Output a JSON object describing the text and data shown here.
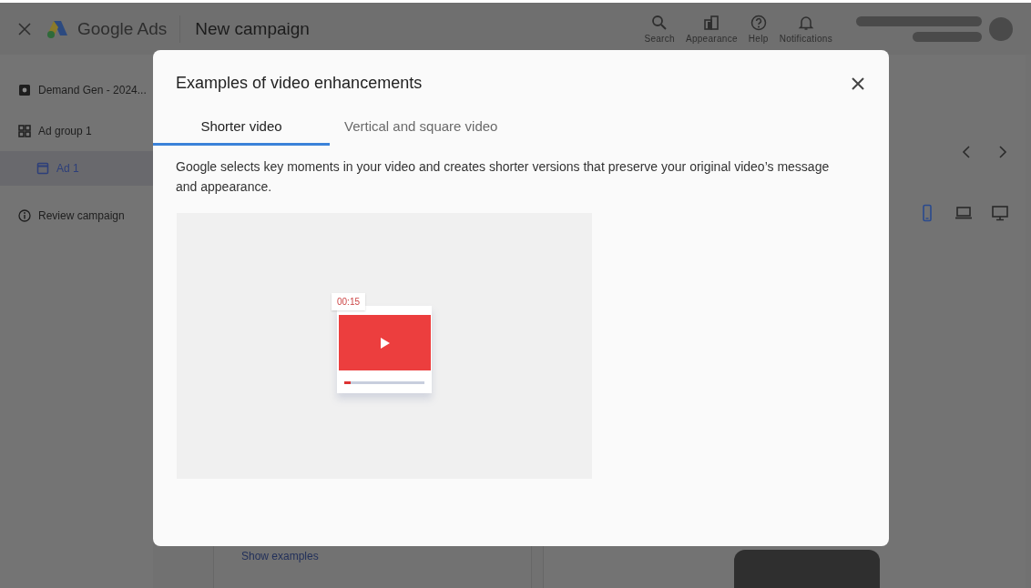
{
  "app_bar": {
    "product": "Google Ads",
    "page_title": "New campaign",
    "actions": [
      {
        "kind": "search",
        "label": "Search"
      },
      {
        "kind": "appearance",
        "label": "Appearance"
      },
      {
        "kind": "help",
        "label": "Help"
      },
      {
        "kind": "notifications",
        "label": "Notifications"
      }
    ]
  },
  "sidebar": {
    "items": [
      {
        "kind": "campaign",
        "label": "Demand Gen - 2024...",
        "selected": false,
        "children": [
          {
            "kind": "ad_group",
            "label": "Ad group 1",
            "selected": false,
            "children": [
              {
                "kind": "ad",
                "label": "Ad 1",
                "selected": true
              }
            ]
          }
        ]
      },
      {
        "kind": "review",
        "label": "Review campaign",
        "selected": false
      }
    ]
  },
  "editor": {
    "link": "Show examples",
    "devices": [
      {
        "kind": "phone",
        "selected": true
      },
      {
        "kind": "laptop",
        "selected": false
      },
      {
        "kind": "monitor",
        "selected": false
      }
    ]
  },
  "dialog": {
    "title": "Examples of video enhancements",
    "tabs": [
      {
        "label": "Shorter video",
        "selected": true
      },
      {
        "label": "Vertical and square video",
        "selected": false
      }
    ],
    "description": "Google selects key moments in your video and creates shorter versions that preserve your original video’s message and appearance.",
    "video": {
      "timestamp": "00:15",
      "level": 0.08
    }
  }
}
